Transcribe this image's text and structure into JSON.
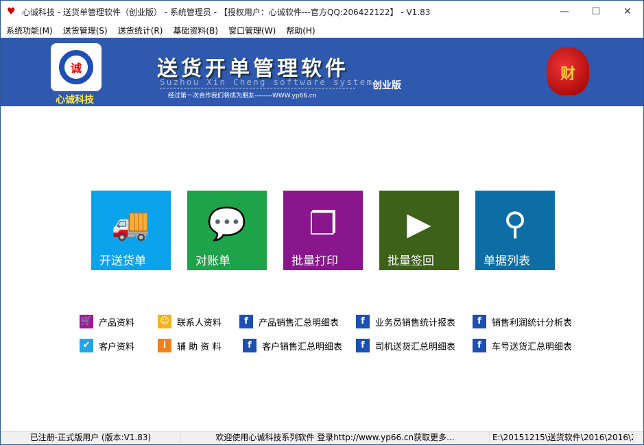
{
  "window": {
    "title": "心诚科技 - 送货单管理软件（创业版） - 系统管理员 - 【授权用户：心诚软件---官方QQ:206422122】 - V1.83",
    "minimize": "—",
    "maximize": "☐",
    "close": "✕"
  },
  "menu": [
    "系统功能(M)",
    "送货管理(S)",
    "送货统计(R)",
    "基础资料(B)",
    "窗口管理(W)",
    "帮助(H)"
  ],
  "banner": {
    "logo_char": "诚",
    "logo_text": "心诚科技",
    "title": "送货开单管理软件",
    "subtitle": "Suzhou Xin Cheng software system",
    "motto": "经过第一次合作我们将成为朋友--------WWW.yp66.cn",
    "edition": "创业版",
    "bag_char": "财"
  },
  "tiles": [
    {
      "label": "开送货单",
      "icon": "truck-icon",
      "color": "#0ba3ec"
    },
    {
      "label": "对账单",
      "icon": "chat-icon",
      "color": "#1ea24a"
    },
    {
      "label": "批量打印",
      "icon": "copy-icon",
      "color": "#8a168d"
    },
    {
      "label": "批量签回",
      "icon": "play-icon",
      "color": "#3d6118"
    },
    {
      "label": "单据列表",
      "icon": "search-icon",
      "color": "#0c6ea5"
    }
  ],
  "links": [
    {
      "label": "产品资料",
      "icon": "cart-icon",
      "color": "#9b1b93"
    },
    {
      "label": "联系人资料",
      "icon": "contacts-icon",
      "color": "#f0b31e"
    },
    {
      "label": "产品销售汇总明细表",
      "icon": "report-icon",
      "color": "#1c4fb0"
    },
    {
      "label": "业务员销售统计报表",
      "icon": "report-icon",
      "color": "#1c4fb0"
    },
    {
      "label": "销售利润统计分析表",
      "icon": "report-icon",
      "color": "#1c4fb0"
    },
    {
      "label": "客户资料",
      "icon": "bird-icon",
      "color": "#22a6e8"
    },
    {
      "label": "辅 助 资 料",
      "icon": "info-icon",
      "color": "#f0821e"
    },
    {
      "label": "客户销售汇总明细表",
      "icon": "report-icon",
      "color": "#1c4fb0"
    },
    {
      "label": "司机送货汇总明细表",
      "icon": "report-icon",
      "color": "#1c4fb0"
    },
    {
      "label": "车号送货汇总明细表",
      "icon": "report-icon",
      "color": "#1c4fb0"
    }
  ],
  "status": [
    "已注册-正式版用户 (版本:V1.83)",
    "欢迎使用心诚科技系列软件   登录http://www.yp66.cn获取更多...",
    "E:\\20151215\\送货软件\\2016\\2016\\2"
  ]
}
